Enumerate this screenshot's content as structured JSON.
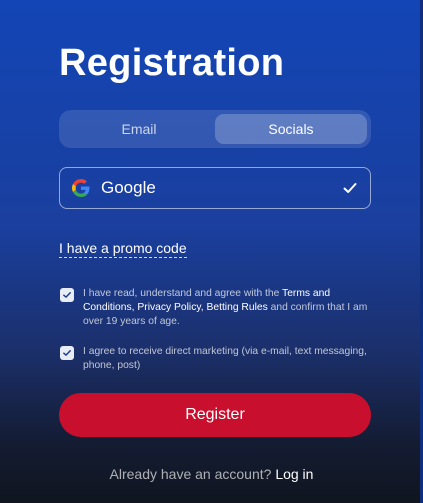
{
  "page": {
    "title": "Registration"
  },
  "tabs": [
    {
      "label": "Email",
      "active": false
    },
    {
      "label": "Socials",
      "active": true
    }
  ],
  "social_select": {
    "value": "Google",
    "icon": "google-icon",
    "status_icon": "checkmark-icon"
  },
  "promo": {
    "label": "I have a promo code"
  },
  "terms": {
    "prefix": "I have read, understand and agree with the",
    "link1": "Terms and Conditions",
    "sep1": ",",
    "link2": "Privacy Policy",
    "sep2": ",",
    "link3": "Betting Rules",
    "suffix": "and confirm that I am over 19 years of age.",
    "checked": true
  },
  "marketing": {
    "text": "I agree to receive direct marketing (via e-mail, text messaging, phone, post)",
    "checked": true
  },
  "register_button": {
    "label": "Register"
  },
  "login": {
    "prompt": "Already have an account?",
    "link": "Log in"
  },
  "colors": {
    "accent": "#c8102e",
    "bg_top": "#1345b6",
    "bg_bottom": "#10151f"
  }
}
